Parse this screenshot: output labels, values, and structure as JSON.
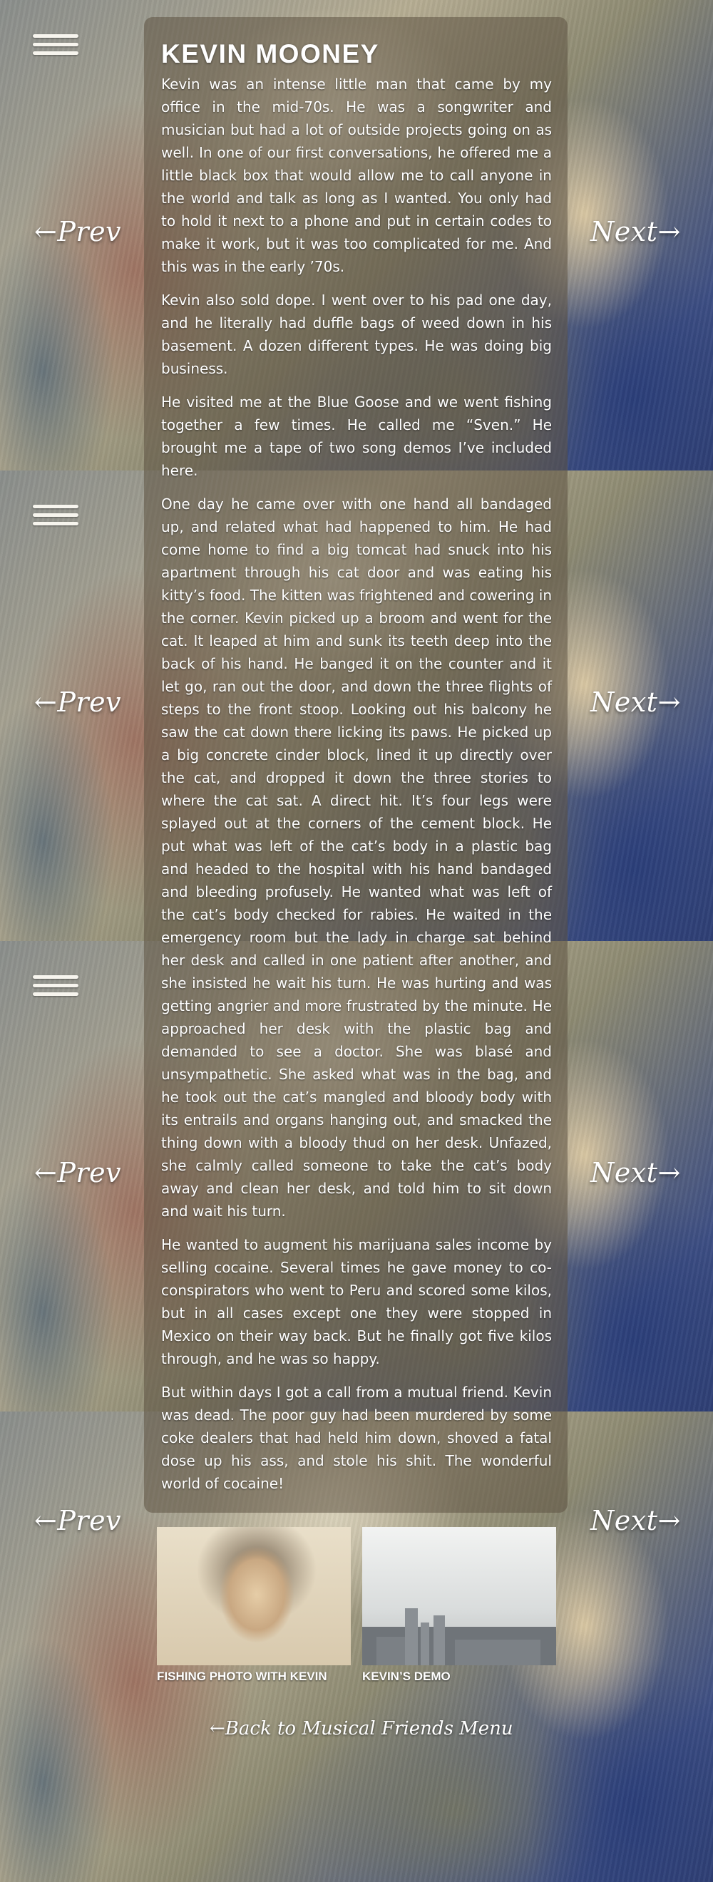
{
  "nav": {
    "prev_label": "←Prev",
    "next_label": "Next→",
    "back_label": "←Back to Musical Friends Menu"
  },
  "article": {
    "title": "KEVIN MOONEY",
    "paragraphs": [
      "Kevin was an intense little man that came by my office in the mid-70s. He was a songwriter and musician but had a lot of outside projects going on as well. In one of our first conversations, he offered me a little black box that would allow me to call anyone in the world and talk as long as I wanted. You only had to hold it next to a phone and put in certain codes to make it work, but it was too complicated for me. And this was in the early ’70s.",
      "Kevin also sold dope. I went over to his pad one day, and he literally had duffle bags of weed down in his basement. A dozen different types. He was doing big business.",
      "He visited me at the Blue Goose and we went fishing together a few times. He called me “Sven.” He brought me a tape of two song demos I’ve included here.",
      "One day he came over with one hand all bandaged up, and related what had happened to him. He had come home to find a big tomcat had snuck into his apartment through his cat door and was eating his kitty’s food. The kitten was frightened and cowering in the corner. Kevin picked up a broom and went for the cat. It leaped at him and sunk its teeth deep into the back of his hand. He banged it on the counter and it let go, ran out the door, and down the three flights of steps to the front stoop. Looking out his balcony he saw the cat down there licking its paws. He picked up a big concrete cinder block, lined it up directly over the cat, and dropped it down the three stories to where the cat sat. A direct hit. It’s four legs were splayed out at the corners of the cement block. He put what was left of the cat’s body in a plastic bag and headed to the hospital with his hand bandaged and bleeding profusely. He wanted what was left of the cat’s body checked for rabies. He waited in the emergency room but the lady in charge sat behind her desk and called in one patient after another, and she insisted he wait his turn. He was hurting and was getting angrier and more frustrated by the minute. He approached her desk with the plastic bag and demanded to see a doctor. She was blasé and unsympathetic. She asked what was in the bag, and he took out the cat’s mangled and bloody body with its entrails and organs hanging out, and smacked the thing down with a bloody thud on her desk. Unfazed, she calmly called someone to take the cat’s body away and clean her desk, and told him to sit down and wait his turn.",
      "He wanted to augment his marijuana sales income by selling cocaine. Several times he gave money to co-conspirators who went to Peru and scored some kilos, but in all cases except one they were stopped in Mexico on their way back. But he finally got five kilos through, and he was so happy.",
      "But within days I got a call from a mutual friend. Kevin was dead. The poor guy had been murdered by some coke dealers that had held him down, shoved a fatal dose up his ass, and stole his shit. The wonderful world of cocaine!"
    ]
  },
  "thumbnails": [
    {
      "caption": "FISHING PHOTO WITH KEVIN"
    },
    {
      "caption": "KEVIN’S DEMO"
    }
  ],
  "colors": {
    "panel": "#5c5242",
    "text": "#ffffff"
  }
}
